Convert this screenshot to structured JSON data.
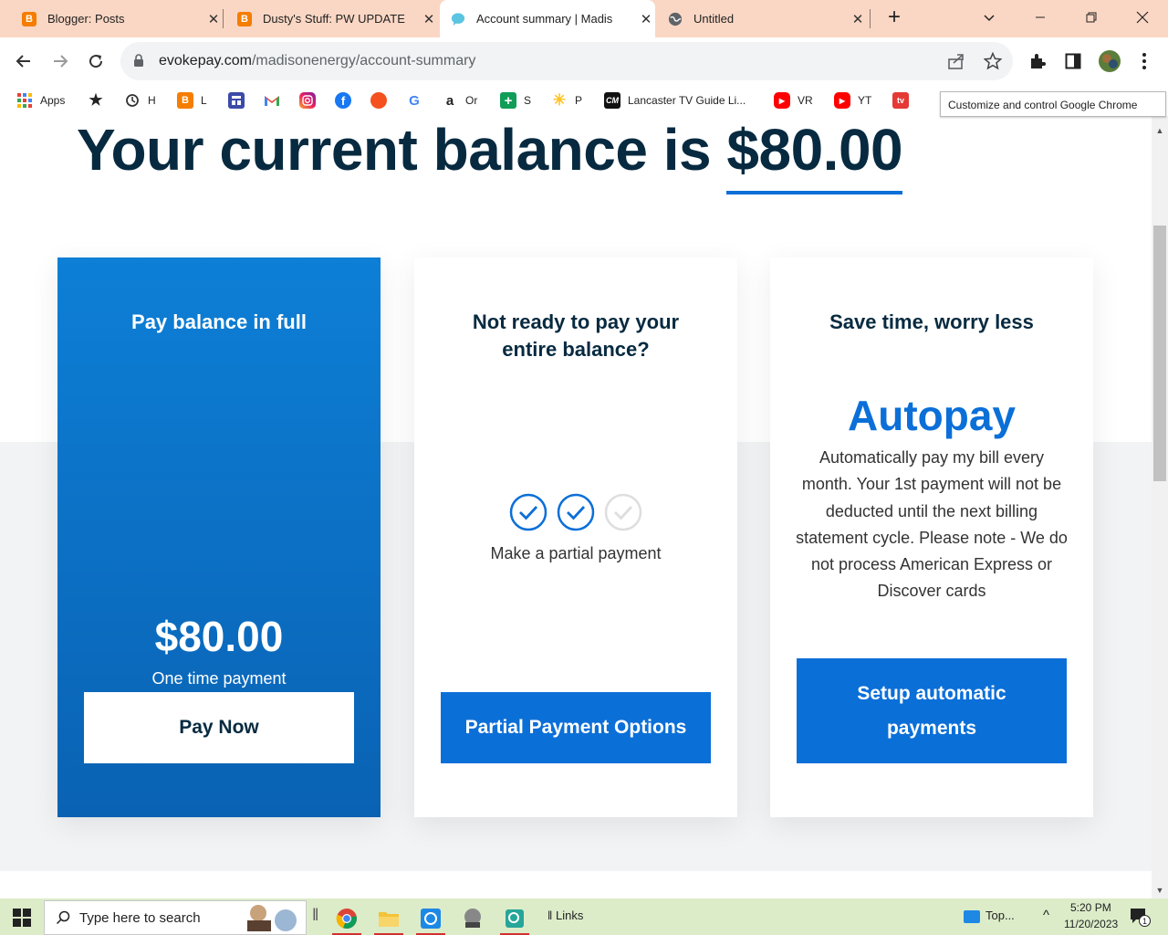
{
  "browser": {
    "tabs": [
      {
        "title": "Blogger: Posts",
        "icon": "blogger-icon"
      },
      {
        "title": "Dusty's Stuff: PW UPDATE",
        "icon": "blogger-icon"
      },
      {
        "title": "Account summary | Madis",
        "icon": "chat-bubble-icon",
        "active": true
      },
      {
        "title": "Untitled",
        "icon": "globe-icon"
      }
    ],
    "new_tab": "+",
    "url_host": "evokepay.com",
    "url_path": "/madisonenergy/account-summary",
    "bookmarks": [
      {
        "label": "Apps",
        "icon": "apps-grid-icon"
      },
      {
        "label": "",
        "icon": "star-icon"
      },
      {
        "label": "H",
        "icon": "history-icon"
      },
      {
        "label": "L",
        "icon": "blogger-icon"
      },
      {
        "label": "",
        "icon": "calendar-icon"
      },
      {
        "label": "",
        "icon": "gmail-icon"
      },
      {
        "label": "",
        "icon": "instagram-icon"
      },
      {
        "label": "",
        "icon": "facebook-icon"
      },
      {
        "label": "",
        "icon": "orange-sun-icon"
      },
      {
        "label": "",
        "icon": "google-icon"
      },
      {
        "label": "Or",
        "icon": "amazon-icon"
      },
      {
        "label": "S",
        "icon": "green-plus-icon"
      },
      {
        "label": "P",
        "icon": "walmart-icon"
      },
      {
        "label": "Lancaster TV Guide Li...",
        "icon": "cm-icon"
      },
      {
        "label": "VR",
        "icon": "youtube-icon"
      },
      {
        "label": "YT",
        "icon": "youtube-icon"
      },
      {
        "label": "",
        "icon": "tv-icon"
      }
    ],
    "tooltip": "Customize and control Google Chrome"
  },
  "page": {
    "headline_prefix": "Your current balance is ",
    "headline_amount": "$80.00",
    "cards": {
      "pay_full": {
        "title": "Pay balance in full",
        "amount": "$80.00",
        "amount_caption": "One time payment",
        "button": "Pay Now"
      },
      "partial": {
        "title": "Not ready to pay your entire balance?",
        "caption": "Make a partial payment",
        "button": "Partial Payment Options",
        "steps_checked": 2,
        "steps_total": 3
      },
      "autopay": {
        "title": "Save time, worry less",
        "heading": "Autopay",
        "description": "Automatically pay my bill every month. Your 1st payment will not be deducted until the next billing statement cycle. Please note - We do not process American Express or Discover cards",
        "button": "Setup automatic payments"
      }
    },
    "colors": {
      "brand_blue": "#0b6fd8",
      "navy_text": "#072a40",
      "tab_strip": "#fad7c4"
    }
  },
  "taskbar": {
    "search_placeholder": "Type here to search",
    "links_label": "Links",
    "news_label": "Top...",
    "time": "5:20 PM",
    "date": "11/20/2023",
    "notification_count": "1"
  }
}
